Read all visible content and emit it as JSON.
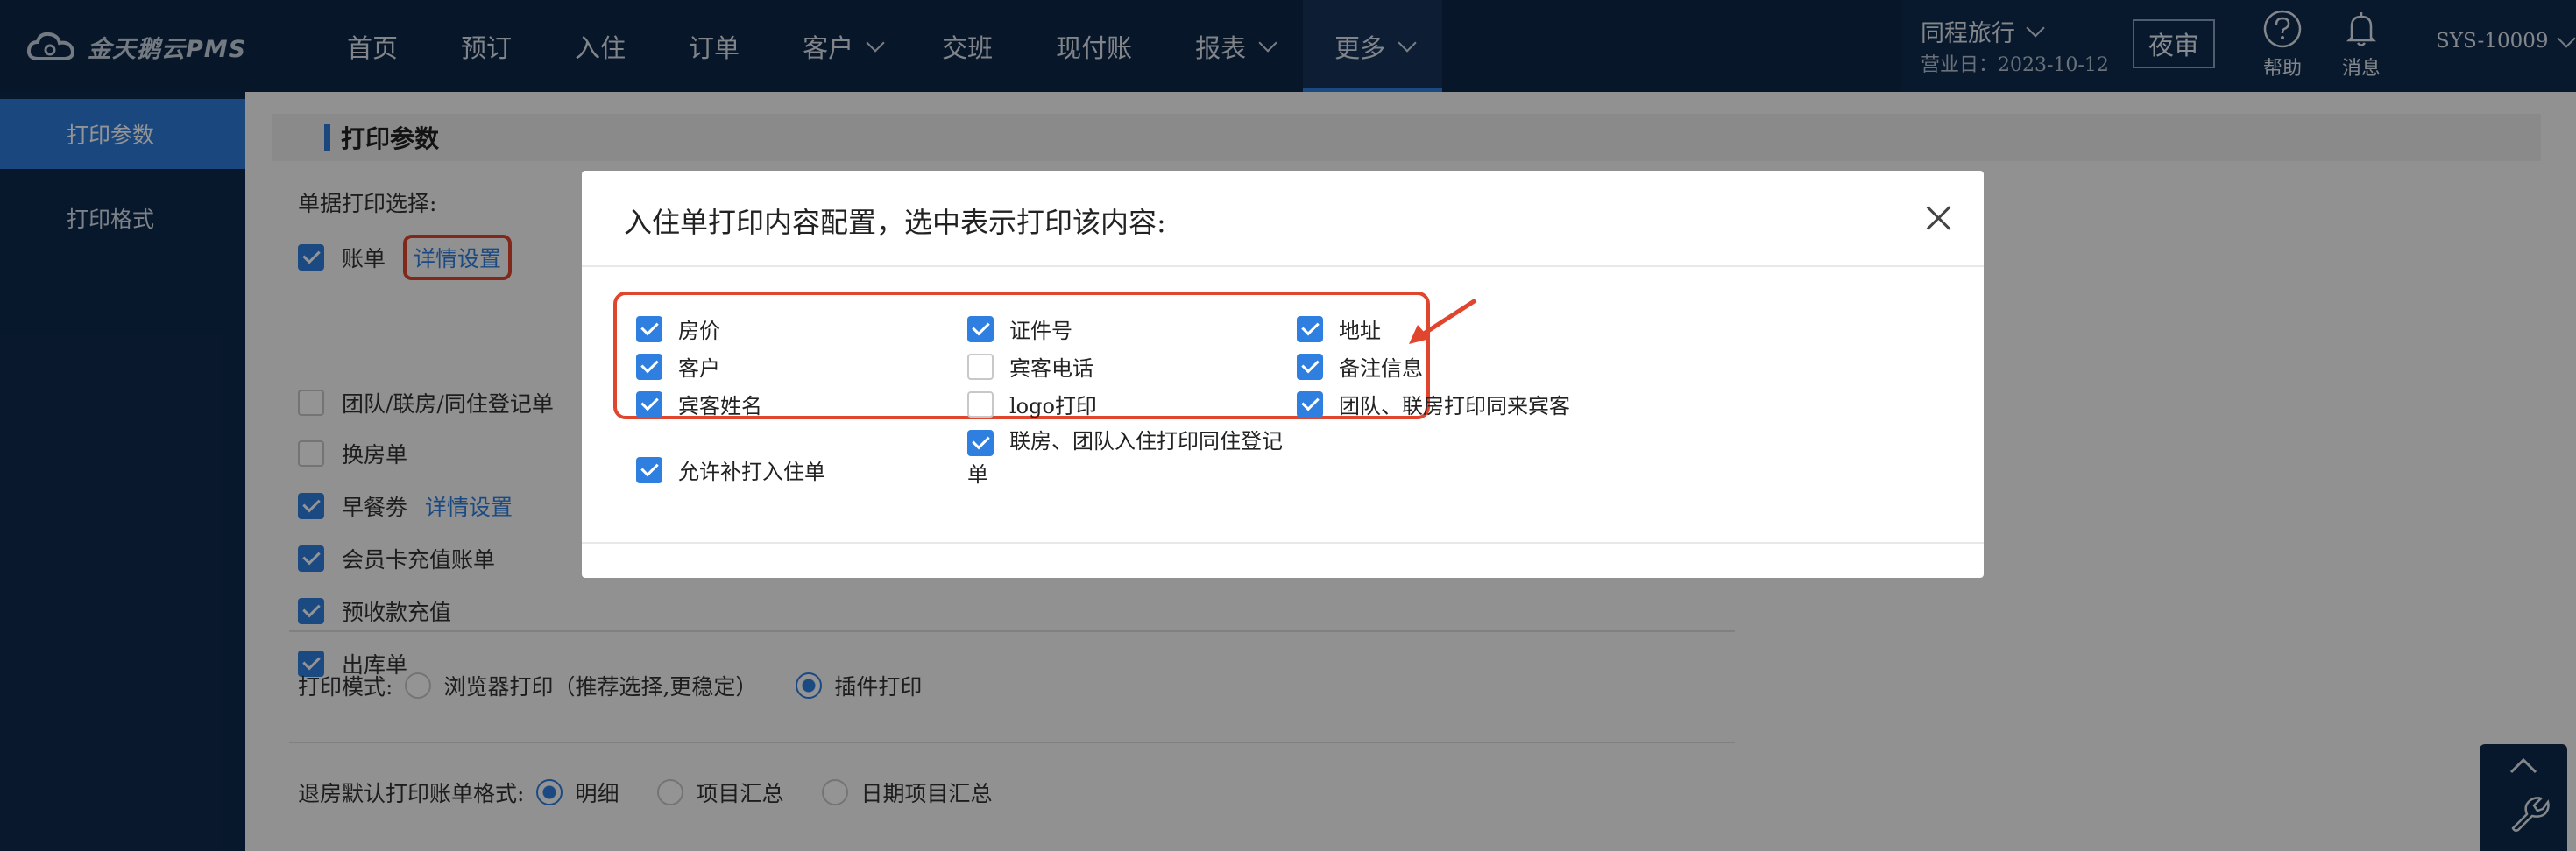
{
  "app": {
    "logo_text": "金天鹅云PMS"
  },
  "nav": {
    "items": [
      {
        "label": "首页",
        "dropdown": false,
        "active": false
      },
      {
        "label": "预订",
        "dropdown": false,
        "active": false
      },
      {
        "label": "入住",
        "dropdown": false,
        "active": false
      },
      {
        "label": "订单",
        "dropdown": false,
        "active": false
      },
      {
        "label": "客户",
        "dropdown": true,
        "active": false
      },
      {
        "label": "交班",
        "dropdown": false,
        "active": false
      },
      {
        "label": "现付账",
        "dropdown": false,
        "active": false
      },
      {
        "label": "报表",
        "dropdown": true,
        "active": false
      },
      {
        "label": "更多",
        "dropdown": true,
        "active": true
      }
    ]
  },
  "header": {
    "hotel_name": "同程旅行",
    "business_date": "营业日：2023-10-12",
    "night_audit_label": "夜审",
    "help_label": "帮助",
    "message_label": "消息",
    "user": "SYS-10009"
  },
  "sidebar": {
    "items": [
      {
        "label": "打印参数",
        "active": true
      },
      {
        "label": "打印格式",
        "active": false
      }
    ]
  },
  "main": {
    "section_title": "打印参数",
    "doc_select_label": "单据打印选择:",
    "doc_options": [
      {
        "label": "账单",
        "checked": true,
        "link": "详情设置"
      },
      {
        "label": "团队/联房/同住登记单",
        "checked": false,
        "link": ""
      },
      {
        "label": "换房单",
        "checked": false,
        "link": ""
      },
      {
        "label": "早餐劵",
        "checked": true,
        "link": "详情设置"
      },
      {
        "label": "会员卡充值账单",
        "checked": true,
        "link": ""
      },
      {
        "label": "预收款充值",
        "checked": true,
        "link": ""
      },
      {
        "label": "出库单",
        "checked": true,
        "link": ""
      }
    ],
    "print_mode_label": "打印模式:",
    "print_modes": [
      {
        "label": "浏览器打印（推荐选择,更稳定）",
        "selected": false
      },
      {
        "label": "插件打印",
        "selected": true
      }
    ],
    "checkout_format_label": "退房默认打印账单格式:",
    "checkout_formats": [
      {
        "label": "明细",
        "selected": true
      },
      {
        "label": "项目汇总",
        "selected": false
      },
      {
        "label": "日期项目汇总",
        "selected": false
      }
    ]
  },
  "modal": {
    "title": "入住单打印内容配置，选中表示打印该内容:",
    "options": [
      {
        "label": "房价",
        "checked": true
      },
      {
        "label": "证件号",
        "checked": true
      },
      {
        "label": "地址",
        "checked": true
      },
      {
        "label": "客户",
        "checked": true
      },
      {
        "label": "宾客电话",
        "checked": false
      },
      {
        "label": "备注信息",
        "checked": true
      },
      {
        "label": "宾客姓名",
        "checked": true
      },
      {
        "label": "logo打印",
        "checked": false
      },
      {
        "label": "团队、联房打印同来宾客",
        "checked": true
      },
      {
        "label": "允许补打入住单",
        "checked": true
      },
      {
        "label": "联房、团队入住打印同住登记单",
        "checked": true
      }
    ]
  },
  "colors": {
    "nav_bg": "#0e2747",
    "accent": "#2f7fe0",
    "highlight_red": "#e0452e"
  }
}
